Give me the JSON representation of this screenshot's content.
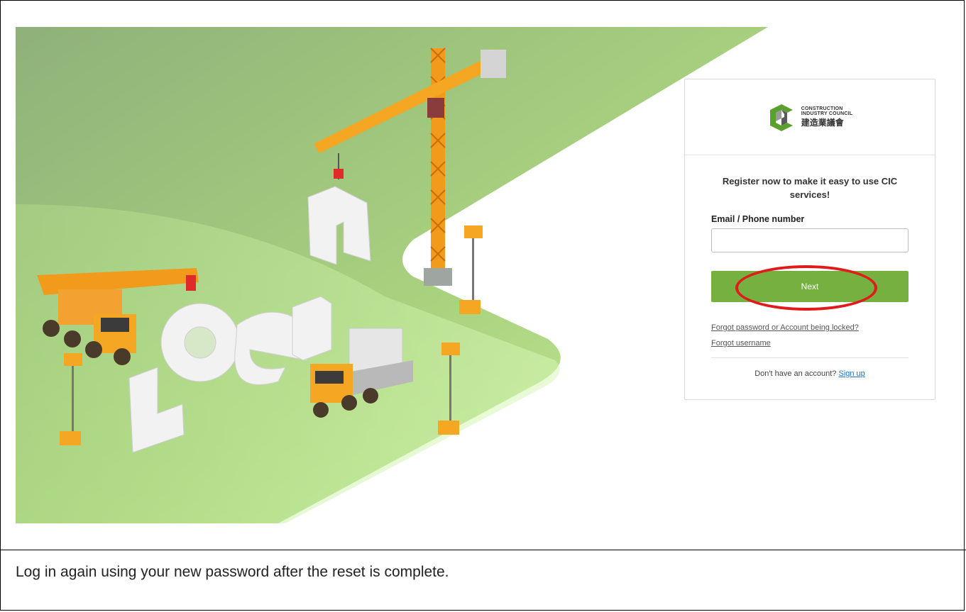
{
  "login_card": {
    "logo": {
      "name_en_line1": "CONSTRUCTION",
      "name_en_line2": "INDUSTRY COUNCIL",
      "name_zh": "建造業議會"
    },
    "headline": "Register now to make it easy to use CIC services!",
    "email_field": {
      "label": "Email / Phone number",
      "value": "",
      "placeholder": ""
    },
    "next_button": "Next",
    "forgot_password_link": "Forgot password or Account being locked?",
    "forgot_username_link": "Forgot username",
    "signup_prompt": "Don't have an account?",
    "signup_link": "Sign up"
  },
  "caption": "Log in again using your new password after the reset is complete.",
  "colors": {
    "accent_green": "#76b041",
    "highlight_red": "#e11b1b",
    "link_blue": "#1a73c8"
  }
}
